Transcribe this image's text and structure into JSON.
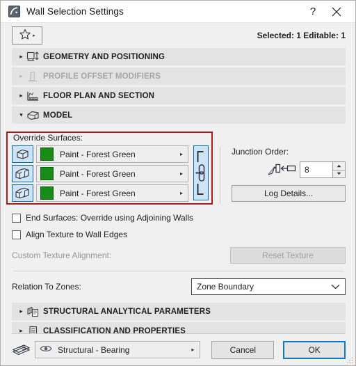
{
  "window": {
    "title": "Wall Selection Settings",
    "app_icon": "archicad-wall-icon",
    "help_label": "?",
    "close_label": "✕"
  },
  "toolbar": {
    "favorites_icon": "star-icon",
    "favorites_caret": "▸",
    "selection_status": "Selected: 1 Editable: 1"
  },
  "sections": [
    {
      "label": "GEOMETRY AND POSITIONING",
      "icon": "geometry-icon",
      "expanded": false,
      "disabled": false,
      "triangle": "▸"
    },
    {
      "label": "PROFILE OFFSET MODIFIERS",
      "icon": "profile-offset-icon",
      "expanded": false,
      "disabled": true,
      "triangle": "▸"
    },
    {
      "label": "FLOOR PLAN AND SECTION",
      "icon": "floor-plan-icon",
      "expanded": false,
      "disabled": false,
      "triangle": "▸"
    },
    {
      "label": "MODEL",
      "icon": "model-box-icon",
      "expanded": true,
      "disabled": false,
      "triangle": "▾"
    },
    {
      "label": "STRUCTURAL ANALYTICAL PARAMETERS",
      "icon": "structural-analytical-icon",
      "expanded": false,
      "disabled": false,
      "triangle": "▸"
    },
    {
      "label": "CLASSIFICATION AND PROPERTIES",
      "icon": "classification-icon",
      "expanded": false,
      "disabled": false,
      "triangle": "▸"
    }
  ],
  "model": {
    "override_surfaces_label": "Override Surfaces:",
    "highlight_color": "#a31f1f",
    "surface_swatch_color": "#178c17",
    "surfaces": [
      {
        "icon": "wall-outside-face-icon",
        "name": "Paint - Forest Green",
        "arrow": "▸"
      },
      {
        "icon": "wall-inside-face-icon",
        "name": "Paint - Forest Green",
        "arrow": "▸"
      },
      {
        "icon": "wall-edge-face-icon",
        "name": "Paint - Forest Green",
        "arrow": "▸"
      }
    ],
    "link_surfaces_icon": "chain-link-icon",
    "junction": {
      "label": "Junction Order:",
      "glyph_icon": "junction-order-icon",
      "value": "8",
      "spinner_up": "▲",
      "spinner_down": "▼"
    },
    "log_details_label": "Log Details...",
    "checkboxes": [
      {
        "label": "End Surfaces: Override using Adjoining Walls",
        "checked": false
      },
      {
        "label": "Align Texture to Wall Edges",
        "checked": false
      }
    ],
    "custom_texture_label": "Custom Texture Alignment:",
    "reset_texture_label": "Reset Texture",
    "relation_label": "Relation To Zones:",
    "relation_value": "Zone Boundary",
    "relation_chevron": "⌄"
  },
  "footer": {
    "layer_stack_icon": "layer-stack-icon",
    "layer_eye_icon": "eye-icon",
    "layer_name": "Structural - Bearing",
    "layer_arrow": "▸",
    "cancel_label": "Cancel",
    "ok_label": "OK",
    "accent_color": "#1476c8"
  }
}
